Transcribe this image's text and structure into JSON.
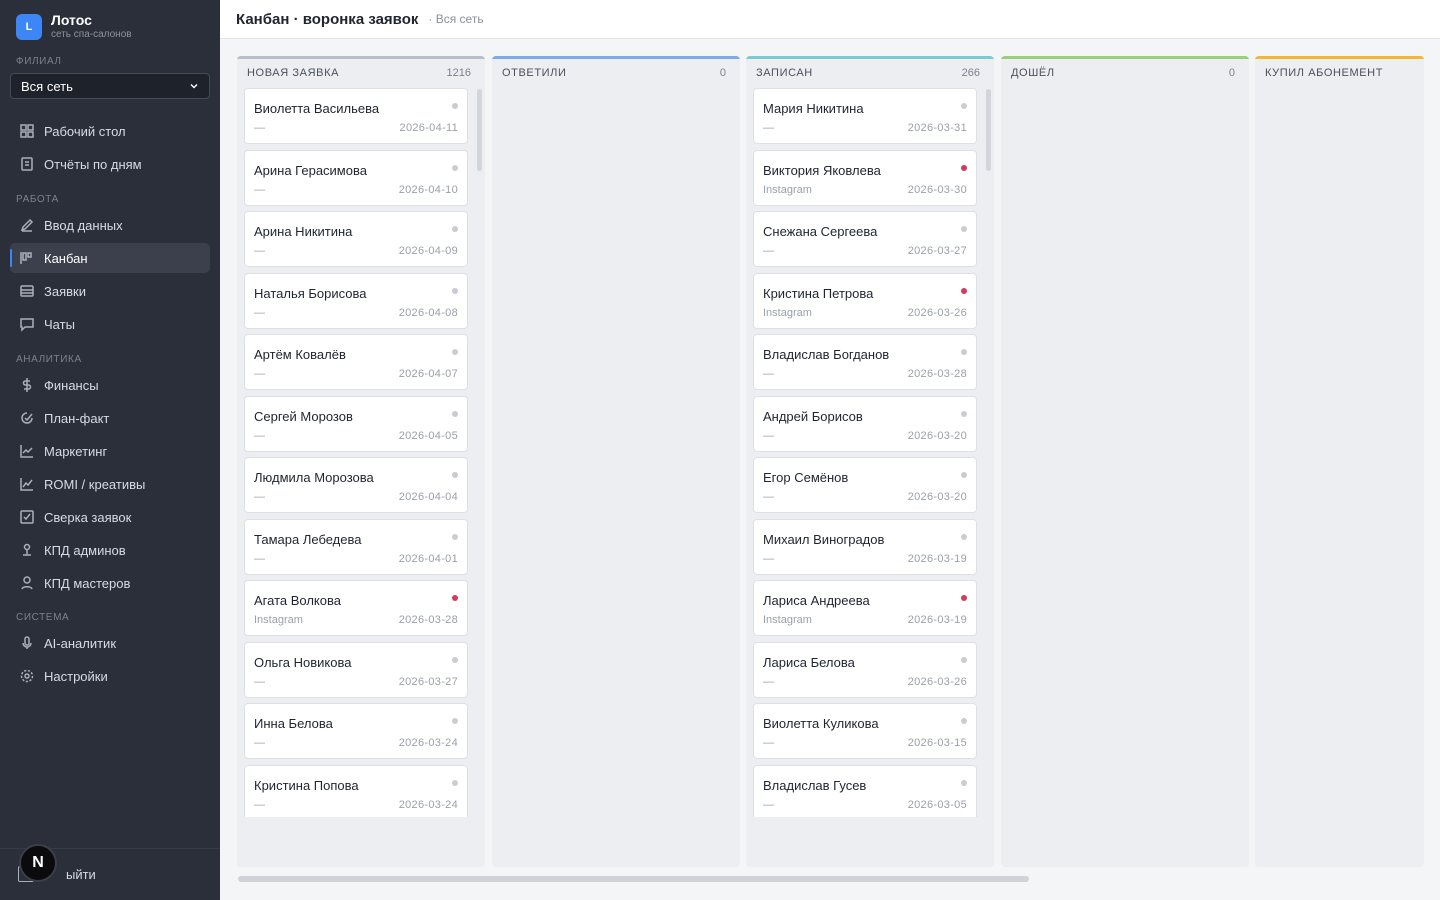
{
  "brand": {
    "logo_letter": "L",
    "name": "Лотос",
    "subtitle": "сеть спа-салонов"
  },
  "sidebar": {
    "branch_label": "ФИЛИАЛ",
    "branch_value": "Вся сеть",
    "top_items": [
      {
        "label": "Рабочий стол",
        "icon": "dashboard-icon"
      },
      {
        "label": "Отчёты по дням",
        "icon": "report-icon"
      }
    ],
    "work_label": "РАБОТА",
    "work_items": [
      {
        "label": "Ввод данных",
        "icon": "pencil-icon"
      },
      {
        "label": "Канбан",
        "icon": "kanban-icon",
        "active": true
      },
      {
        "label": "Заявки",
        "icon": "inbox-icon"
      },
      {
        "label": "Чаты",
        "icon": "chat-icon"
      }
    ],
    "analytics_label": "АНАЛИТИКА",
    "analytics_items": [
      {
        "label": "Финансы",
        "icon": "dollar-icon"
      },
      {
        "label": "План-факт",
        "icon": "target-icon"
      },
      {
        "label": "Маркетинг",
        "icon": "line-chart-icon"
      },
      {
        "label": "ROMI / креативы",
        "icon": "trend-icon"
      },
      {
        "label": "Сверка заявок",
        "icon": "checkbox-icon"
      },
      {
        "label": "КПД админов",
        "icon": "admin-icon"
      },
      {
        "label": "КПД мастеров",
        "icon": "user-icon"
      }
    ],
    "system_label": "СИСТЕМА",
    "system_items": [
      {
        "label": "AI-аналитик",
        "icon": "mic-icon"
      },
      {
        "label": "Настройки",
        "icon": "gear-icon"
      }
    ],
    "logout_label": "Выйти",
    "logout_visible": "ыйти",
    "next_badge": "N"
  },
  "header": {
    "title": "Канбан · воронка заявок",
    "subtitle": "· Вся сеть"
  },
  "colors": {
    "accent": "#3d86f5",
    "hot_dot": "#d23b5c",
    "col_new": "#b8bfca",
    "col_replied": "#82a8e6",
    "col_booked": "#7fcbd2",
    "col_came": "#9ad07a",
    "col_bought": "#f2b53a"
  },
  "columns": [
    {
      "title": "НОВАЯ ЗАЯВКА",
      "count": "1216",
      "color": "#b8bfca",
      "cards": [
        {
          "name": "Виолетта Васильева",
          "source": "—",
          "date": "2026-04-11",
          "hot": false
        },
        {
          "name": "Арина Герасимова",
          "source": "—",
          "date": "2026-04-10",
          "hot": false
        },
        {
          "name": "Арина Никитина",
          "source": "—",
          "date": "2026-04-09",
          "hot": false
        },
        {
          "name": "Наталья Борисова",
          "source": "—",
          "date": "2026-04-08",
          "hot": false
        },
        {
          "name": "Артём Ковалёв",
          "source": "—",
          "date": "2026-04-07",
          "hot": false
        },
        {
          "name": "Сергей Морозов",
          "source": "—",
          "date": "2026-04-05",
          "hot": false
        },
        {
          "name": "Людмила Морозова",
          "source": "—",
          "date": "2026-04-04",
          "hot": false
        },
        {
          "name": "Тамара Лебедева",
          "source": "—",
          "date": "2026-04-01",
          "hot": false
        },
        {
          "name": "Агата Волкова",
          "source": "Instagram",
          "date": "2026-03-28",
          "hot": true
        },
        {
          "name": "Ольга Новикова",
          "source": "—",
          "date": "2026-03-27",
          "hot": false
        },
        {
          "name": "Инна Белова",
          "source": "—",
          "date": "2026-03-24",
          "hot": false
        },
        {
          "name": "Кристина Попова",
          "source": "—",
          "date": "2026-03-24",
          "hot": false
        }
      ]
    },
    {
      "title": "ОТВЕТИЛИ",
      "count": "0",
      "color": "#82a8e6",
      "cards": []
    },
    {
      "title": "ЗАПИСАН",
      "count": "266",
      "color": "#7fcbd2",
      "cards": [
        {
          "name": "Мария Никитина",
          "source": "—",
          "date": "2026-03-31",
          "hot": false
        },
        {
          "name": "Виктория Яковлева",
          "source": "Instagram",
          "date": "2026-03-30",
          "hot": true
        },
        {
          "name": "Снежана Сергеева",
          "source": "—",
          "date": "2026-03-27",
          "hot": false
        },
        {
          "name": "Кристина Петрова",
          "source": "Instagram",
          "date": "2026-03-26",
          "hot": true
        },
        {
          "name": "Владислав Богданов",
          "source": "—",
          "date": "2026-03-28",
          "hot": false
        },
        {
          "name": "Андрей Борисов",
          "source": "—",
          "date": "2026-03-20",
          "hot": false
        },
        {
          "name": "Егор Семёнов",
          "source": "—",
          "date": "2026-03-20",
          "hot": false
        },
        {
          "name": "Михаил Виноградов",
          "source": "—",
          "date": "2026-03-19",
          "hot": false
        },
        {
          "name": "Лариса Андреева",
          "source": "Instagram",
          "date": "2026-03-19",
          "hot": true
        },
        {
          "name": "Лариса Белова",
          "source": "—",
          "date": "2026-03-26",
          "hot": false
        },
        {
          "name": "Виолетта Куликова",
          "source": "—",
          "date": "2026-03-15",
          "hot": false
        },
        {
          "name": "Владислав Гусев",
          "source": "—",
          "date": "2026-03-05",
          "hot": false
        }
      ]
    },
    {
      "title": "ДОШЁЛ",
      "count": "0",
      "color": "#9ad07a",
      "cards": []
    },
    {
      "title": "КУПИЛ АБОНЕМЕНТ",
      "count": "",
      "color": "#f2b53a",
      "cards": []
    }
  ]
}
